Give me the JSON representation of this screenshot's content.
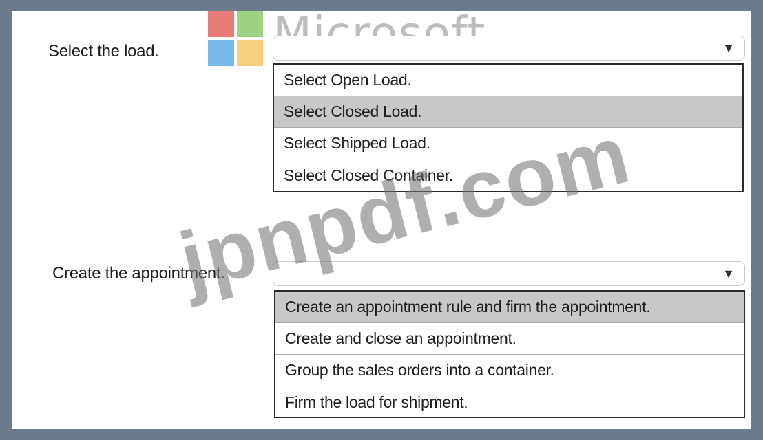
{
  "watermark": {
    "brand_text": "Microsoft",
    "site_text": "jpnpdf.com"
  },
  "questions": [
    {
      "label": "Select the load.",
      "selected_value": "",
      "options": [
        "Select Open Load.",
        "Select Closed Load.",
        "Select Shipped Load.",
        "Select Closed Container."
      ],
      "highlighted_index": 1
    },
    {
      "label": "Create the appointment.",
      "selected_value": "",
      "options": [
        "Create an appointment rule and firm the appointment.",
        "Create and close an appointment.",
        "Group the sales orders into a container.",
        "Firm the load for shipment."
      ],
      "highlighted_index": 0
    }
  ],
  "icons": {
    "dropdown": "chevron-down-icon",
    "logo": "microsoft-logo-icon"
  }
}
